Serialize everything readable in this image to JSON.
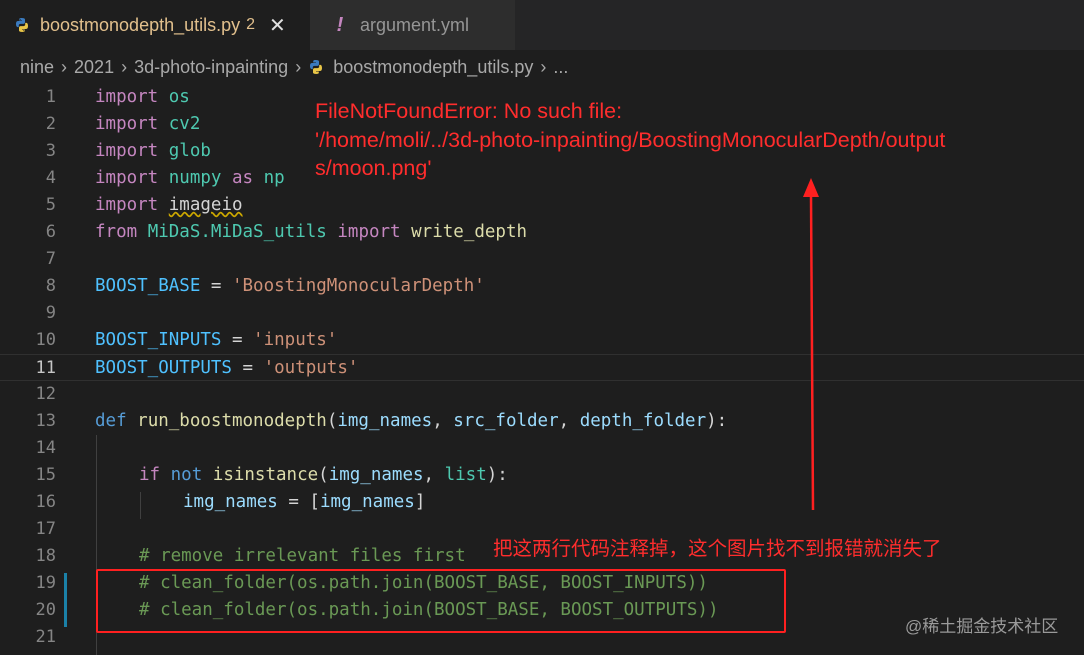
{
  "tabs": [
    {
      "label": "boostmonodepth_utils.py",
      "badge": "2",
      "close": "✕",
      "active": true
    },
    {
      "label": "argument.yml",
      "icon": "!",
      "active": false
    }
  ],
  "breadcrumb": [
    "nine",
    "2021",
    "3d-photo-inpainting",
    "boostmonodepth_utils.py",
    "..."
  ],
  "breadcrumb_sep": "›",
  "gutter": [
    "1",
    "2",
    "3",
    "4",
    "5",
    "6",
    "7",
    "8",
    "9",
    "10",
    "11",
    "12",
    "13",
    "14",
    "15",
    "16",
    "17",
    "18",
    "19",
    "20",
    "21"
  ],
  "code": {
    "l1": [
      "import",
      "os"
    ],
    "l2": [
      "import",
      "cv2"
    ],
    "l3": [
      "import",
      "glob"
    ],
    "l4": [
      "import",
      "numpy",
      "as",
      "np"
    ],
    "l5": [
      "import",
      "imageio"
    ],
    "l6": [
      "from",
      "MiDaS.MiDaS_utils",
      "import",
      "write_depth"
    ],
    "l8": [
      "BOOST_BASE",
      " = ",
      "'BoostingMonocularDepth'"
    ],
    "l10": [
      "BOOST_INPUTS",
      " = ",
      "'inputs'"
    ],
    "l11": [
      "BOOST_OUTPUTS",
      " = ",
      "'outputs'"
    ],
    "l13": [
      "def",
      "run_boostmonodepth",
      "(",
      "img_names",
      ", ",
      "src_folder",
      ", ",
      "depth_folder",
      "):"
    ],
    "l15": [
      "if",
      "not",
      "isinstance",
      "(",
      "img_names",
      ", ",
      "list",
      "):"
    ],
    "l16": [
      "img_names",
      " = [",
      "img_names",
      "]"
    ],
    "l18": "# remove irrelevant files first",
    "l19": "# clean_folder(os.path.join(BOOST_BASE, BOOST_INPUTS))",
    "l20": "# clean_folder(os.path.join(BOOST_BASE, BOOST_OUTPUTS))"
  },
  "annotations": {
    "error_lines": [
      "FileNotFoundError: No such file:",
      "'/home/moli/../3d-photo-inpainting/BoostingMonocularDepth/output",
      "s/moon.png'"
    ],
    "note": "把这两行代码注释掉，这个图片找不到报错就消失了",
    "color": "#ff2d2d"
  },
  "watermark": "@稀土掘金技术社区"
}
